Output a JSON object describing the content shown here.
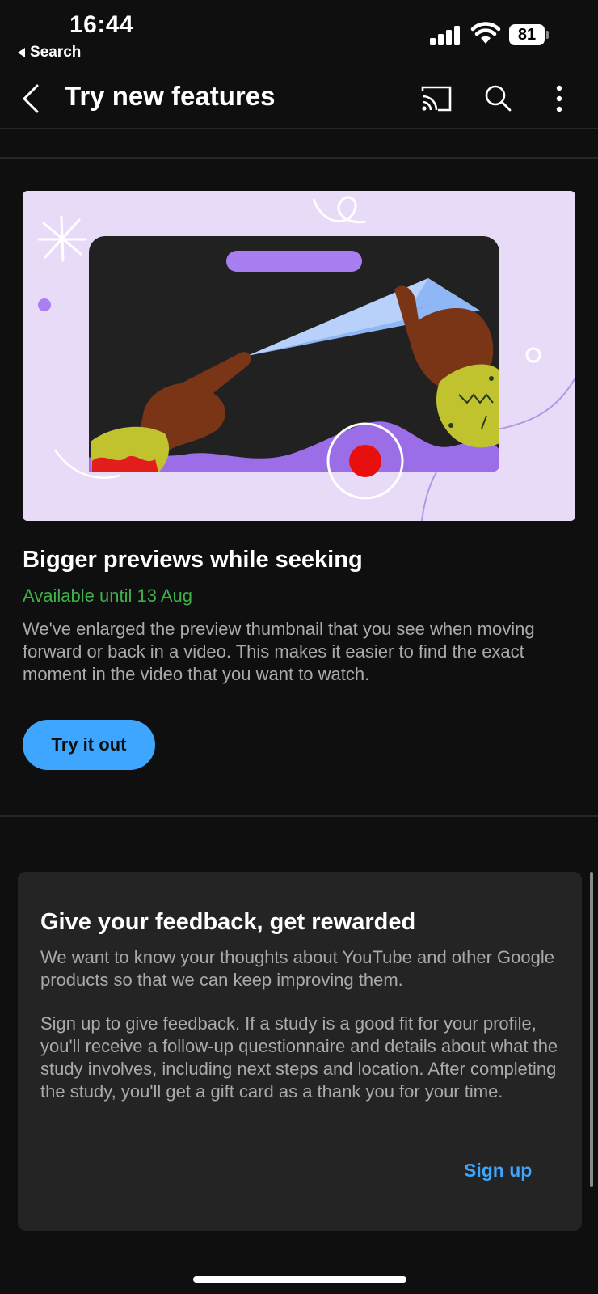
{
  "status_bar": {
    "time": "16:44",
    "back_app": "Search",
    "battery": "81"
  },
  "header": {
    "title": "Try new features",
    "back_icon": "chevron-left-icon",
    "cast_icon": "cast-icon",
    "search_icon": "search-icon",
    "more_icon": "more-vert-icon"
  },
  "feature": {
    "title": "Bigger previews while seeking",
    "availability": "Available until 13 Aug",
    "description": "We've enlarged the preview thumbnail that you see when moving forward or back in a video. This makes it easier to find the exact moment in the video that you want to watch.",
    "button_label": "Try it out",
    "colors": {
      "accent": "#3ea6ff",
      "availability": "#3fb04a",
      "hero_bg": "#e8dbf7"
    }
  },
  "feedback": {
    "title": "Give your feedback, get rewarded",
    "paragraph1": "We want to know your thoughts about YouTube and other Google products so that we can keep improving them.",
    "paragraph2": "Sign up to give feedback. If a study is a good fit for your profile, you'll receive a follow-up questionnaire and details about what the study involves, including next steps and location. After completing the study, you'll get a gift card as a thank you for your time.",
    "link_label": "Sign up"
  }
}
